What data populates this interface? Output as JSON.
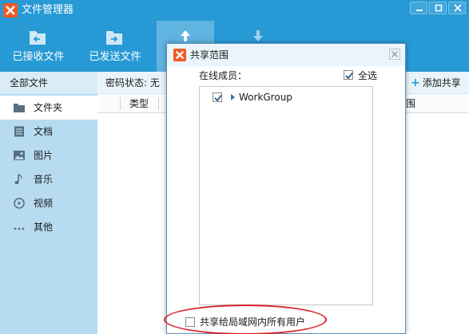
{
  "window": {
    "title": "文件管理器"
  },
  "toolbar": {
    "items": [
      {
        "label": "已接收文件",
        "icon": "received-files-icon"
      },
      {
        "label": "已发送文件",
        "icon": "sent-files-icon"
      },
      {
        "label": "",
        "icon": "upload-icon",
        "active": true
      },
      {
        "label": "",
        "icon": "download-icon"
      }
    ]
  },
  "sidebar": {
    "header": "全部文件",
    "items": [
      {
        "label": "文件夹",
        "icon": "folder-icon",
        "selected": true
      },
      {
        "label": "文档",
        "icon": "document-icon"
      },
      {
        "label": "图片",
        "icon": "picture-icon"
      },
      {
        "label": "音乐",
        "icon": "music-icon"
      },
      {
        "label": "视频",
        "icon": "video-icon"
      },
      {
        "label": "其他",
        "icon": "more-icon"
      }
    ]
  },
  "content": {
    "password_status": "密码状态: 无",
    "add_share": "添加共享",
    "columns": [
      "类型",
      "围"
    ]
  },
  "dialog": {
    "title": "共享范围",
    "members_label": "在线成员：",
    "select_all_label": "全选",
    "select_all_checked": true,
    "tree": [
      {
        "label": "WorkGroup",
        "checked": true,
        "collapsed": true
      }
    ],
    "lan_share_label": "共享给局域网内所有用户",
    "lan_share_checked": false
  },
  "colors": {
    "titlebar": "#279ad5",
    "sidebar": "#b7dcf1",
    "highlight": "#d8232a",
    "logo": "#f05a24"
  }
}
